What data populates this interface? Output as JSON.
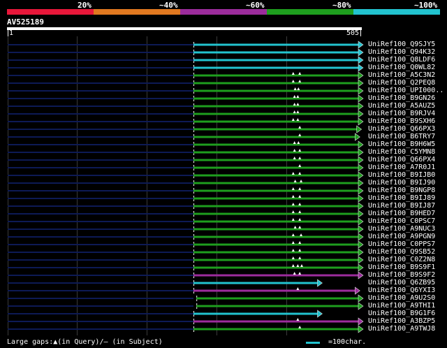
{
  "scale": {
    "segments": [
      {
        "label": "20%",
        "color": "#e8173a"
      },
      {
        "label": "~40%",
        "color": "#e07820"
      },
      {
        "label": "~60%",
        "color": "#9c2c9c"
      },
      {
        "label": "~80%",
        "color": "#1e9e1e"
      },
      {
        "label": "~100%",
        "color": "#22c3cf"
      }
    ]
  },
  "query": {
    "name": "AV525189",
    "start": "1",
    "end": "505",
    "length": 505
  },
  "colors": {
    "cyan": "#22c3cf",
    "green": "#1e9e1e",
    "purple": "#9c2c9c",
    "dark": "#0d1a55",
    "grid": "#3a3a3a",
    "gap": "#ffffff"
  },
  "hits": [
    {
      "label": "UniRef100_Q9SJY5",
      "start": 1,
      "end": 505,
      "color": "cyan",
      "gaps": []
    },
    {
      "label": "UniRef100_Q94K32",
      "start": 1,
      "end": 505,
      "color": "cyan",
      "gaps": []
    },
    {
      "label": "UniRef100_Q8LDF6",
      "start": 1,
      "end": 505,
      "color": "cyan",
      "gaps": []
    },
    {
      "label": "UniRef100_Q0WL82",
      "start": 1,
      "end": 505,
      "color": "cyan",
      "gaps": []
    },
    {
      "label": "UniRef100_A5C3N2",
      "start": 1,
      "end": 505,
      "color": "green",
      "gaps": [
        306,
        326
      ]
    },
    {
      "label": "UniRef100_Q2PEQ8",
      "start": 1,
      "end": 505,
      "color": "green",
      "gaps": [
        306,
        326
      ]
    },
    {
      "label": "UniRef100_UPI000..",
      "start": 1,
      "end": 505,
      "color": "green",
      "gaps": [
        312,
        322
      ]
    },
    {
      "label": "UniRef100_B9GN26",
      "start": 1,
      "end": 505,
      "color": "green",
      "gaps": [
        310,
        320
      ]
    },
    {
      "label": "UniRef100_A5AUZ5",
      "start": 1,
      "end": 505,
      "color": "green",
      "gaps": [
        310,
        320
      ]
    },
    {
      "label": "UniRef100_B9RJV4",
      "start": 1,
      "end": 505,
      "color": "green",
      "gaps": [
        310,
        320
      ]
    },
    {
      "label": "UniRef100_B9SXH6",
      "start": 1,
      "end": 505,
      "color": "green",
      "gaps": [
        306,
        320
      ]
    },
    {
      "label": "UniRef100_Q66PX3",
      "start": 1,
      "end": 500,
      "color": "green",
      "gaps": [
        326
      ]
    },
    {
      "label": "UniRef100_B6TRY7",
      "start": 1,
      "end": 495,
      "color": "green",
      "gaps": [
        326
      ]
    },
    {
      "label": "UniRef100_B9H6W5",
      "start": 1,
      "end": 505,
      "color": "green",
      "gaps": [
        310,
        322
      ]
    },
    {
      "label": "UniRef100_C5YMN8",
      "start": 1,
      "end": 505,
      "color": "green",
      "gaps": [
        310,
        326
      ]
    },
    {
      "label": "UniRef100_Q66PX4",
      "start": 1,
      "end": 505,
      "color": "green",
      "gaps": [
        310,
        326
      ]
    },
    {
      "label": "UniRef100_A7R0J1",
      "start": 1,
      "end": 505,
      "color": "green",
      "gaps": [
        326
      ]
    },
    {
      "label": "UniRef100_B9IJB0",
      "start": 1,
      "end": 505,
      "color": "green",
      "gaps": [
        306,
        326
      ]
    },
    {
      "label": "UniRef100_B9IJ90",
      "start": 1,
      "end": 505,
      "color": "green",
      "gaps": [
        312,
        330
      ]
    },
    {
      "label": "UniRef100_B9NGP8",
      "start": 1,
      "end": 505,
      "color": "green",
      "gaps": [
        306,
        326
      ]
    },
    {
      "label": "UniRef100_B9IJ89",
      "start": 1,
      "end": 505,
      "color": "green",
      "gaps": [
        306,
        326
      ]
    },
    {
      "label": "UniRef100_B9IJ87",
      "start": 1,
      "end": 505,
      "color": "green",
      "gaps": [
        306,
        326
      ]
    },
    {
      "label": "UniRef100_B9HED7",
      "start": 1,
      "end": 505,
      "color": "green",
      "gaps": [
        306,
        326
      ]
    },
    {
      "label": "UniRef100_C0PSC7",
      "start": 1,
      "end": 505,
      "color": "green",
      "gaps": [
        306,
        326
      ]
    },
    {
      "label": "UniRef100_A9NUC3",
      "start": 1,
      "end": 505,
      "color": "green",
      "gaps": [
        312,
        326
      ]
    },
    {
      "label": "UniRef100_A9PGN9",
      "start": 1,
      "end": 505,
      "color": "green",
      "gaps": [
        306,
        330
      ]
    },
    {
      "label": "UniRef100_C0PPS7",
      "start": 1,
      "end": 505,
      "color": "green",
      "gaps": [
        306,
        326
      ]
    },
    {
      "label": "UniRef100_Q9SB52",
      "start": 1,
      "end": 505,
      "color": "green",
      "gaps": [
        306,
        326
      ]
    },
    {
      "label": "UniRef100_C0Z2N8",
      "start": 1,
      "end": 505,
      "color": "green",
      "gaps": [
        306,
        326
      ]
    },
    {
      "label": "UniRef100_B9S9F1",
      "start": 1,
      "end": 505,
      "color": "green",
      "gaps": [
        306,
        320,
        332
      ]
    },
    {
      "label": "UniRef100_B9S9F2",
      "start": 1,
      "end": 505,
      "color": "purple",
      "gaps": [
        310,
        326
      ]
    },
    {
      "label": "UniRef100_Q6ZB95",
      "start": 1,
      "end": 380,
      "color": "cyan",
      "gaps": []
    },
    {
      "label": "UniRef100_Q6YXI3",
      "start": 1,
      "end": 495,
      "color": "purple",
      "gaps": [
        320
      ]
    },
    {
      "label": "UniRef100_A9U2S0",
      "start": 10,
      "end": 505,
      "color": "green",
      "gaps": []
    },
    {
      "label": "UniRef100_A9THI1",
      "start": 10,
      "end": 505,
      "color": "green",
      "gaps": []
    },
    {
      "label": "UniRef100_B9G1F6",
      "start": 1,
      "end": 380,
      "color": "cyan",
      "gaps": []
    },
    {
      "label": "UniRef100_A3BZP5",
      "start": 1,
      "end": 505,
      "color": "purple",
      "gaps": [
        320
      ]
    },
    {
      "label": "UniRef100_A9TWJ8",
      "start": 1,
      "end": 505,
      "color": "green",
      "gaps": [
        326
      ]
    }
  ],
  "footer": {
    "gaps_text": "Large gaps:▲(in Query)/— (in Subject)",
    "legend_text": "=100char."
  }
}
